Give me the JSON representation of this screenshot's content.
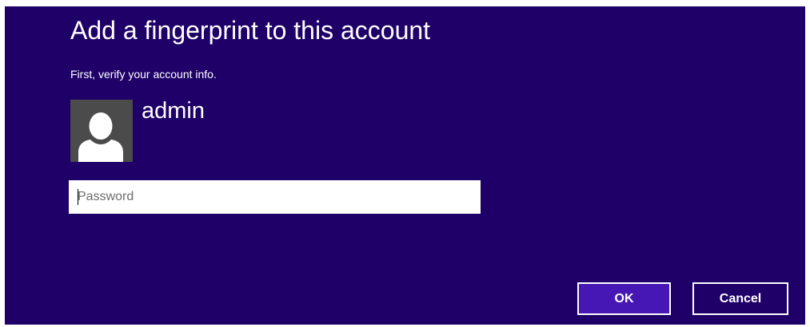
{
  "dialog": {
    "title": "Add a fingerprint to this account",
    "subtitle": "First, verify your account info.",
    "user": {
      "name": "admin",
      "avatar_icon": "user-silhouette-icon"
    },
    "password": {
      "value": "",
      "placeholder": "Password"
    },
    "buttons": {
      "ok_label": "OK",
      "cancel_label": "Cancel"
    }
  },
  "colors": {
    "background": "#1f0068",
    "ok_button": "#4617b4",
    "avatar_bg": "#4b4b4b",
    "text": "#ffffff"
  }
}
